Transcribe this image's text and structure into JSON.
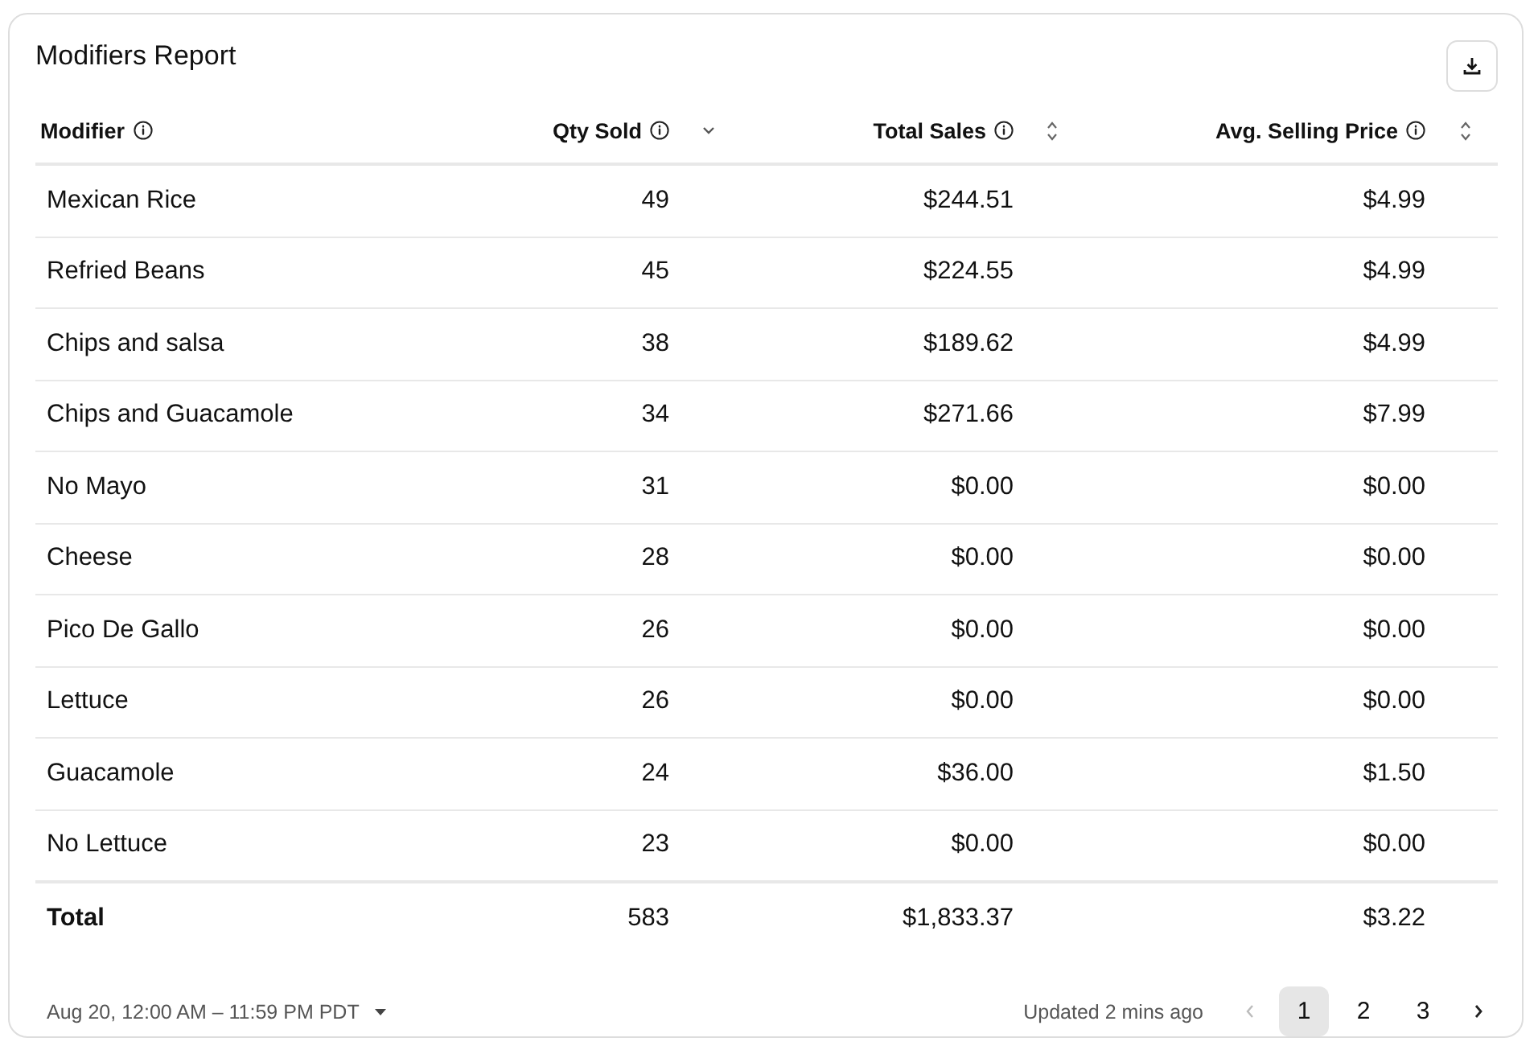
{
  "title": "Modifiers Report",
  "columns": [
    {
      "label": "Modifier",
      "sortable": false
    },
    {
      "label": "Qty Sold",
      "sorted_desc": true,
      "sortable": true
    },
    {
      "label": "Total Sales",
      "sorted_desc": false,
      "sortable": true
    },
    {
      "label": "Avg. Selling Price",
      "sorted_desc": false,
      "sortable": true
    }
  ],
  "rows": [
    [
      "Mexican Rice",
      "49",
      "$244.51",
      "$4.99"
    ],
    [
      "Refried Beans",
      "45",
      "$224.55",
      "$4.99"
    ],
    [
      "Chips and salsa",
      "38",
      "$189.62",
      "$4.99"
    ],
    [
      "Chips and Guacamole",
      "34",
      "$271.66",
      "$7.99"
    ],
    [
      "No Mayo",
      "31",
      "$0.00",
      "$0.00"
    ],
    [
      "Cheese",
      "28",
      "$0.00",
      "$0.00"
    ],
    [
      "Pico De Gallo",
      "26",
      "$0.00",
      "$0.00"
    ],
    [
      "Lettuce",
      "26",
      "$0.00",
      "$0.00"
    ],
    [
      "Guacamole",
      "24",
      "$36.00",
      "$1.50"
    ],
    [
      "No Lettuce",
      "23",
      "$0.00",
      "$0.00"
    ]
  ],
  "total": [
    "Total",
    "583",
    "$1,833.37",
    "$3.22"
  ],
  "date_range": "Aug 20, 12:00 AM – 11:59 PM PDT",
  "updated": "Updated 2 mins ago",
  "pagination": {
    "prev_disabled": true,
    "next_disabled": false,
    "pages": [
      {
        "label": "1",
        "selected": true
      },
      {
        "label": "2",
        "selected": false
      },
      {
        "label": "3",
        "selected": false
      }
    ]
  }
}
